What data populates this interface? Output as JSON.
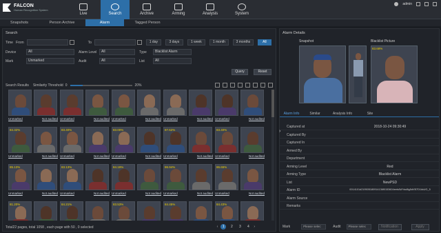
{
  "app": {
    "name": "FALCON",
    "subtitle": "Human Recognition System"
  },
  "nav": [
    {
      "label": "Live",
      "icon": "monitor-icon"
    },
    {
      "label": "Search",
      "icon": "search-icon"
    },
    {
      "label": "Archive",
      "icon": "archive-icon"
    },
    {
      "label": "Arming",
      "icon": "arming-icon"
    },
    {
      "label": "Analysis",
      "icon": "analysis-icon"
    },
    {
      "label": "System",
      "icon": "gear-icon"
    }
  ],
  "user": {
    "name": "admin"
  },
  "subtabs": [
    "Snapshots",
    "Person Archive",
    "Alarm",
    "Tagged Person"
  ],
  "search": {
    "title": "Search",
    "time_label": "Time",
    "from_label": "From",
    "to_label": "To",
    "ranges": [
      "1 day",
      "3 days",
      "1 week",
      "1 month",
      "3 months",
      "All"
    ],
    "device_label": "Device",
    "device_value": "All",
    "alarm_level_label": "Alarm Level",
    "alarm_level_value": "All",
    "type_label": "Type",
    "type_value": "Blacklist Alarm",
    "mark_label": "Mark",
    "mark_value": "Unmarked",
    "audit_label": "Audit",
    "audit_value": "All",
    "list_label": "List",
    "list_value": "All",
    "query_label": "Query",
    "reset_label": "Reset"
  },
  "results": {
    "title": "Search Results",
    "threshold_label": "Similarity Threshold",
    "threshold_min": "0",
    "threshold_value": "20%",
    "threshold_fraction": 0.2,
    "footer": "Total22 pages, total 1058 , each page with 50 , 0 selected",
    "pages": [
      "1",
      "2",
      "3",
      "4"
    ],
    "link_unmarked": "Unmarked",
    "link_not_audited": "Not audited",
    "grid": [
      [
        "",
        "",
        "",
        "",
        ""
      ],
      [
        "84.32%",
        "83.40%",
        "83.00%",
        "87.62%",
        "83.40%"
      ],
      [
        "85.13%",
        "83.13%",
        "84.19%",
        "86.94%",
        "86.65%"
      ],
      [
        "81.20%",
        "84.21%",
        "83.53%",
        "84.45%",
        "84.43%"
      ]
    ]
  },
  "detail": {
    "title": "Alarm Details",
    "snapshot_label": "Snapshot",
    "blacklist_label": "Blacklist Picture",
    "blacklist_score": "83.68%",
    "tabs": [
      "Alarm Info",
      "Similar",
      "Analysis Info",
      "Site"
    ],
    "rows": [
      {
        "k": "Captured at",
        "v": "2018-10-24 09:30:49"
      },
      {
        "k": "Captured By",
        "v": ""
      },
      {
        "k": "Captured In",
        "v": ""
      },
      {
        "k": "Armed By",
        "v": ""
      },
      {
        "k": "Department",
        "v": ""
      },
      {
        "k": "Arming Level",
        "v": "Red"
      },
      {
        "k": "Arming Type",
        "v": "Blacklist Alarm"
      },
      {
        "k": "List",
        "v": "NewPSD"
      },
      {
        "k": "Alarm ID",
        "v": "0014101d219505180914136f0153604eebAWYad8g5dVB7D1kkUG_5"
      },
      {
        "k": "Alarm Source",
        "v": ""
      },
      {
        "k": "Remarks",
        "v": ""
      }
    ],
    "mark_label": "Mark",
    "mark_placeholder": "Please selec",
    "audit_label": "Audit",
    "audit_placeholder": "Please selec",
    "notify_label": "Notification",
    "apply_label": "Apply"
  },
  "colors": {
    "accent": "#2d6fa8",
    "score": "#f0d000"
  }
}
